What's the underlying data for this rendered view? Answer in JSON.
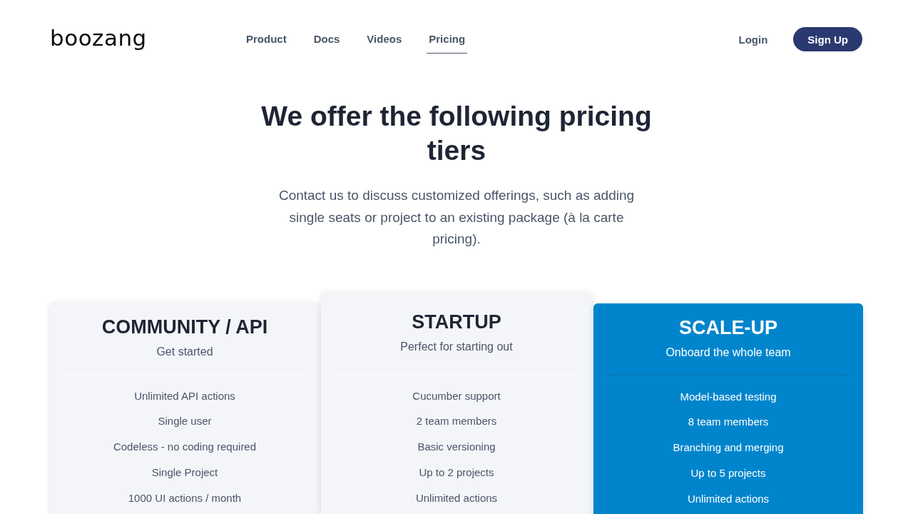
{
  "header": {
    "logo": "boozang",
    "nav": [
      {
        "label": "Product",
        "selected": false
      },
      {
        "label": "Docs",
        "selected": false
      },
      {
        "label": "Videos",
        "selected": false
      },
      {
        "label": "Pricing",
        "selected": true
      }
    ],
    "login": "Login",
    "signup": "Sign Up"
  },
  "hero": {
    "title": "We offer the following pricing tiers",
    "description": "Contact us to discuss customized offerings, such as adding single seats or project to an existing package (à la carte pricing)."
  },
  "tiers": [
    {
      "kind": "plain",
      "name": "COMMUNITY / API",
      "tagline": "Get started",
      "features": [
        "Unlimited API actions",
        "Single user",
        "Codeless - no coding required",
        "Single Project",
        "1000 UI actions / month"
      ]
    },
    {
      "kind": "raised",
      "name": "STARTUP",
      "tagline": "Perfect for starting out",
      "features": [
        "Cucumber support",
        "2 team members",
        "Basic versioning",
        "Up to 2 projects",
        "Unlimited actions"
      ]
    },
    {
      "kind": "accent",
      "name": "SCALE-UP",
      "tagline": "Onboard the whole team",
      "features": [
        "Model-based testing",
        "8 team members",
        "Branching and merging",
        "Up to 5 projects",
        "Unlimited actions"
      ]
    }
  ]
}
